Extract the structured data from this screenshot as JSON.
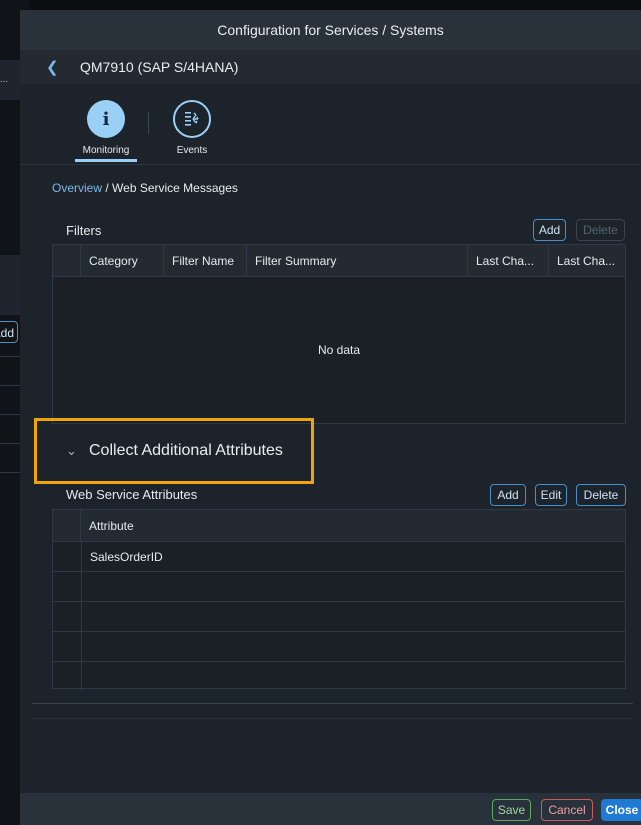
{
  "background_app": {
    "ellipsis": "...",
    "add_label": "Add"
  },
  "dialog": {
    "title": "Configuration for Services / Systems",
    "system": "QM7910 (SAP S/4HANA)",
    "tabs": [
      {
        "label": "Monitoring",
        "icon": "info-icon",
        "glyph": "i",
        "selected": true
      },
      {
        "label": "Events",
        "icon": "events-icon",
        "selected": false
      }
    ],
    "breadcrumb": {
      "link": "Overview",
      "separator": " / ",
      "current": "Web Service Messages"
    },
    "filters": {
      "title": "Filters",
      "add_label": "Add",
      "delete_label": "Delete",
      "columns": [
        "Category",
        "Filter Name",
        "Filter Summary",
        "Last Cha...",
        "Last Cha..."
      ],
      "empty_text": "No data"
    },
    "collect_panel": {
      "title": "Collect Additional Attributes",
      "expanded": true
    },
    "web_service_attributes": {
      "title": "Web Service Attributes",
      "add_label": "Add",
      "edit_label": "Edit",
      "delete_label": "Delete",
      "column": "Attribute",
      "rows": [
        "SalesOrderID",
        "",
        "",
        "",
        ""
      ]
    },
    "footer": {
      "save_label": "Save",
      "cancel_label": "Cancel",
      "close_label": "Close"
    }
  },
  "colors": {
    "accent": "#9ad0f5",
    "highlight": "#f0a30a",
    "save": "#5fa85f",
    "cancel": "#d05a5a",
    "close": "#1f7ad4"
  }
}
